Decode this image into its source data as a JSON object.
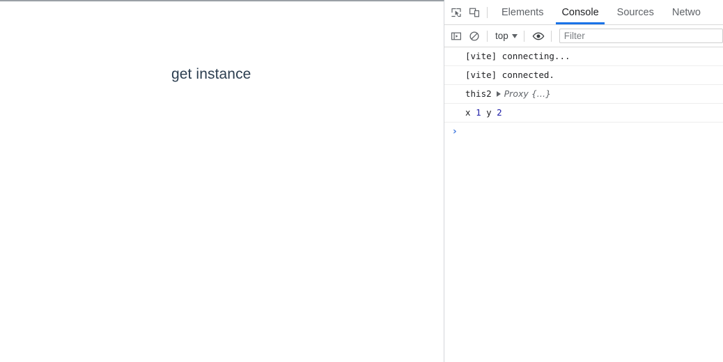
{
  "page": {
    "heading": "get instance"
  },
  "devtools": {
    "icons": {
      "inspect": "inspect-element-icon",
      "device": "device-toolbar-icon",
      "sidebar": "console-sidebar-icon",
      "clear": "clear-console-icon",
      "eye": "live-expression-icon"
    },
    "tabs": [
      {
        "label": "Elements",
        "active": false
      },
      {
        "label": "Console",
        "active": true
      },
      {
        "label": "Sources",
        "active": false
      },
      {
        "label": "Netwo",
        "active": false
      }
    ],
    "toolbar": {
      "context_label": "top",
      "filter_placeholder": "Filter",
      "filter_value": ""
    },
    "console": {
      "messages": [
        {
          "text": "[vite] connecting..."
        },
        {
          "text": "[vite] connected."
        },
        {
          "label": "this2",
          "object_preview": "Proxy {…}"
        },
        {
          "tokens": [
            {
              "t": "x ",
              "kind": "name"
            },
            {
              "t": "1",
              "kind": "num"
            },
            {
              "t": " y ",
              "kind": "name"
            },
            {
              "t": "2",
              "kind": "num"
            }
          ]
        }
      ],
      "prompt_symbol": "›"
    },
    "colors": {
      "accent": "#1a73e8",
      "number": "#1a1aa6",
      "object": "#5f6368",
      "prompt": "#4a7fe0",
      "heading": "#2c3e50"
    }
  }
}
